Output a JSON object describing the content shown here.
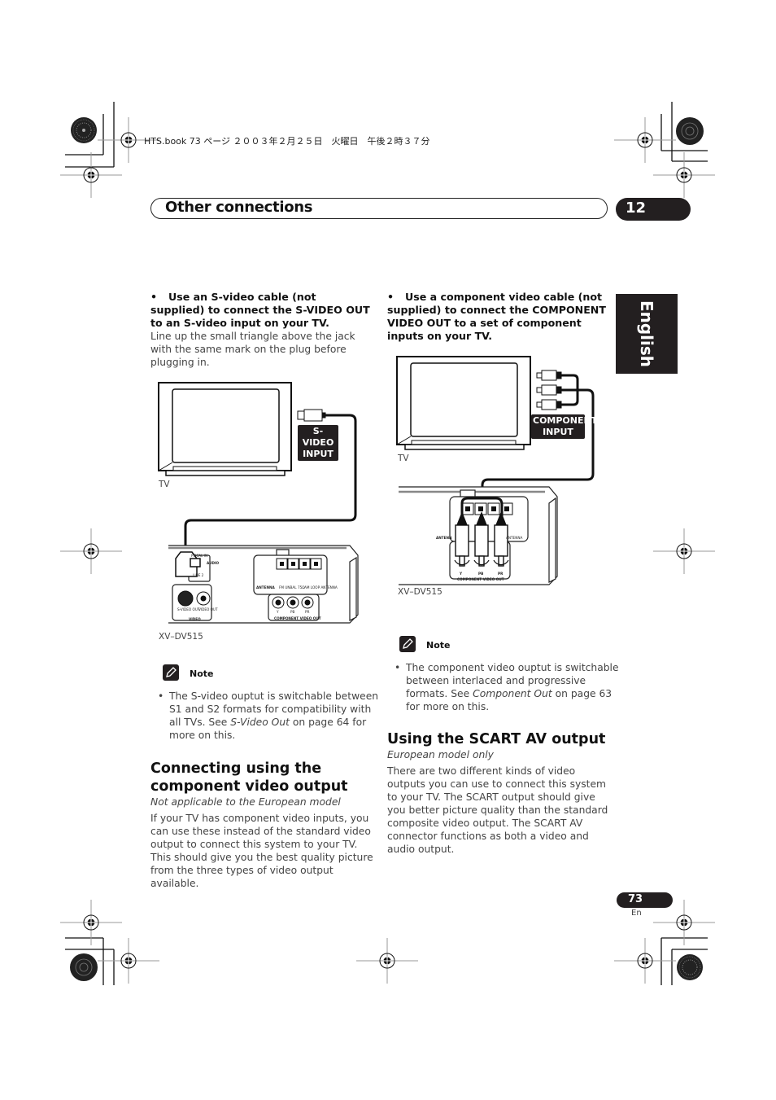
{
  "print_header": {
    "text": "HTS.book  73 ページ  ２００３年２月２５日　火曜日　午後２時３７分"
  },
  "chapter": {
    "title": "Other connections",
    "number": "12"
  },
  "language_tab": "English",
  "left_column": {
    "step": {
      "bullet": "•",
      "bold_text": "Use an S-video cable (not supplied) to connect the S-VIDEO OUT to an S-video input on your TV.",
      "body": "Line up the small triangle above the jack with the same mark on the plug before plugging in."
    },
    "figure": {
      "tv_label": "TV",
      "input_label_line1": "S-VIDEO",
      "input_label_line2": "INPUT",
      "device_label": "XV–DV515",
      "panel_labels": {
        "optical_in": "PTICAL IN",
        "audio": "AUDIO",
        "line2": "LINE 2",
        "svideo_out": "S-VIDEO OUT",
        "video_out": "VIDEO OUT",
        "video": "VIDEO",
        "antenna": "ANTENNA",
        "fm": "FM UNBAL 75Ω",
        "am": "AM LOOP ANTENNA",
        "y": "Y",
        "pb": "PB",
        "pr": "PR",
        "component_video_out": "COMPONENT VIDEO OUT"
      }
    },
    "note": {
      "label": "Note",
      "bullet": "•",
      "text_before": "The S-video ouptut is switchable between S1 and S2 formats for compatibility with all TVs. See ",
      "italic": "S-Video Out",
      "text_after": " on page 64 for more on this."
    },
    "section": {
      "heading": "Connecting using the component video output",
      "subtitle": "Not applicable to the European model",
      "body": "If your TV has component video inputs, you can use these instead of the standard video output to connect this system to your TV. This should give you the best quality picture from the three types of video output available."
    }
  },
  "right_column": {
    "step": {
      "bullet": "•",
      "bold_text": "Use a component video cable (not supplied) to connect the COMPONENT VIDEO OUT to a set of component inputs on your TV."
    },
    "figure": {
      "tv_label": "TV",
      "input_label_line1": "COMPONENT",
      "input_label_line2": "INPUT",
      "device_label": "XV–DV515",
      "panel_labels": {
        "antenna_left": "ANTENN",
        "antenna_right": "ANTENNA",
        "y": "Y",
        "pb": "PB",
        "pr": "PR",
        "component_video_out": "COMPONENT VIDEO OUT"
      }
    },
    "note": {
      "label": "Note",
      "bullet": "•",
      "text_before": "The component video ouptut is switchable between interlaced and progressive formats. See ",
      "italic": "Component Out",
      "text_after": " on page 63 for more on this."
    },
    "section": {
      "heading": "Using the SCART AV output",
      "subtitle": "European model only",
      "body": "There are two different kinds of video outputs you can use to connect this system to your TV. The SCART output should give you better picture quality than the standard composite video output. The SCART AV connector functions as both a video and audio output."
    }
  },
  "footer": {
    "page_number": "73",
    "language": "En"
  }
}
